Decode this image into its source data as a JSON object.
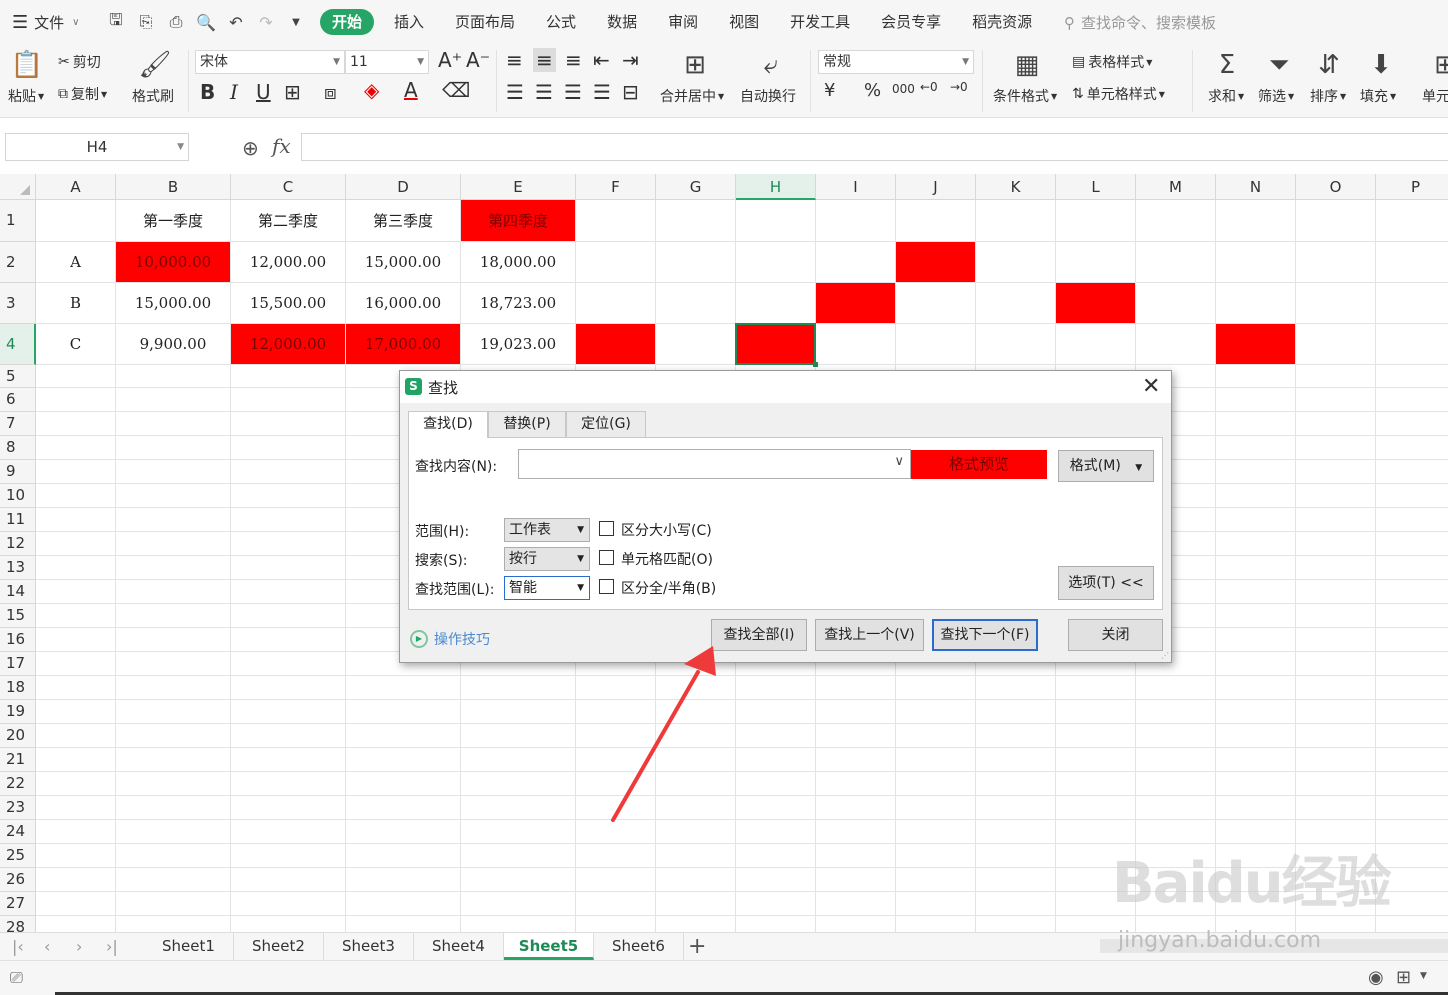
{
  "menubar": {
    "file_label": "文件",
    "tabs": [
      "开始",
      "插入",
      "页面布局",
      "公式",
      "数据",
      "审阅",
      "视图",
      "开发工具",
      "会员专享",
      "稻壳资源"
    ],
    "search_placeholder": "查找命令、搜索模板"
  },
  "ribbon": {
    "paste": "粘贴",
    "cut": "剪切",
    "copy": "复制",
    "format_painter": "格式刷",
    "font_name": "宋体",
    "font_size": "11",
    "merge_center": "合并居中",
    "wrap_text": "自动换行",
    "number_format": "常规",
    "table_style": "表格样式",
    "cell_style": "单元格样式",
    "conditional_format": "条件格式",
    "sum": "求和",
    "filter": "筛选",
    "sort": "排序",
    "fill": "填充",
    "cell": "单元"
  },
  "formula_bar": {
    "name_box": "H4",
    "fx": "fx",
    "value": ""
  },
  "grid": {
    "columns": [
      "A",
      "B",
      "C",
      "D",
      "E",
      "F",
      "G",
      "H",
      "I",
      "J",
      "K",
      "L",
      "M",
      "N",
      "O",
      "P"
    ],
    "rows": [
      "1",
      "2",
      "3",
      "4",
      "5",
      "6",
      "7",
      "8",
      "9",
      "10",
      "11",
      "12",
      "13",
      "14",
      "15",
      "16",
      "17",
      "18",
      "19",
      "20",
      "21",
      "22",
      "23",
      "24",
      "25",
      "26",
      "27",
      "28"
    ],
    "header_row": [
      "",
      "第一季度",
      "第二季度",
      "第三季度",
      "第四季度"
    ],
    "data_rows": [
      [
        "A",
        "10,000.00",
        "12,000.00",
        "15,000.00",
        "18,000.00"
      ],
      [
        "B",
        "15,000.00",
        "15,500.00",
        "16,000.00",
        "18,723.00"
      ],
      [
        "C",
        "9,900.00",
        "12,000.00",
        "17,000.00",
        "19,023.00"
      ]
    ],
    "active_cell": "H4",
    "highlight_color": "#ff0000"
  },
  "sheets": {
    "tabs": [
      "Sheet1",
      "Sheet2",
      "Sheet3",
      "Sheet4",
      "Sheet5",
      "Sheet6"
    ],
    "active": "Sheet5"
  },
  "dialog": {
    "title": "查找",
    "tabs": [
      "查找(D)",
      "替换(P)",
      "定位(G)"
    ],
    "find_label": "查找内容(N):",
    "find_value": "",
    "preview_label": "格式预览",
    "format_button": "格式(M)",
    "range_label": "范围(H):",
    "range_value": "工作表",
    "search_label": "搜索(S):",
    "search_value": "按行",
    "scope_label": "查找范围(L):",
    "scope_value": "智能",
    "match_case": "区分大小写(C)",
    "match_cell": "单元格匹配(O)",
    "match_width": "区分全/半角(B)",
    "options_button": "选项(T) <<",
    "tips_link": "操作技巧",
    "find_all": "查找全部(I)",
    "find_prev": "查找上一个(V)",
    "find_next": "查找下一个(F)",
    "close": "关闭"
  },
  "watermark": {
    "brand": "Baidu经验",
    "url": "jingyan.baidu.com"
  }
}
